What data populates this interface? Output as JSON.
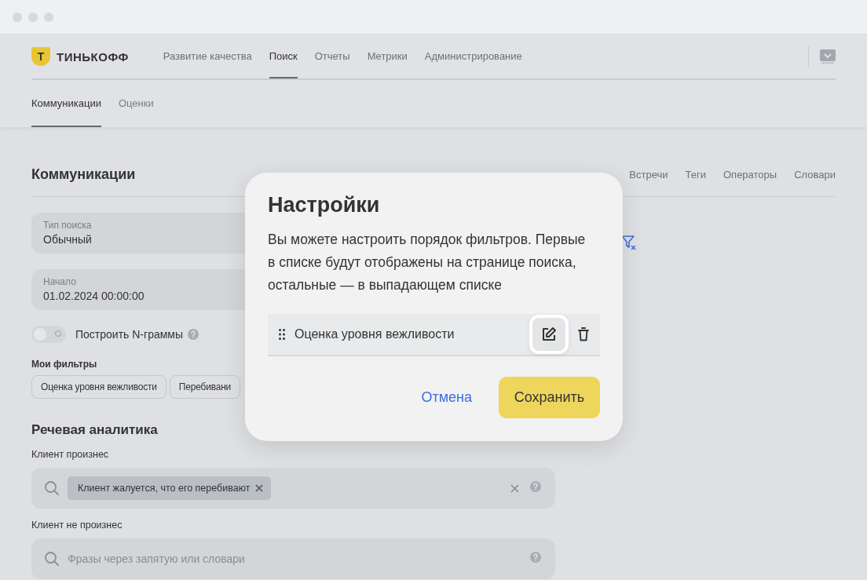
{
  "header": {
    "logo_mark": "Т",
    "logo_text": "ТИНЬКОФФ",
    "nav": [
      {
        "label": "Развитие качества",
        "selected": false
      },
      {
        "label": "Поиск",
        "selected": true
      },
      {
        "label": "Отчеты",
        "selected": false
      },
      {
        "label": "Метрики",
        "selected": false
      },
      {
        "label": "Администрирование",
        "selected": false
      }
    ],
    "subtabs": [
      {
        "label": "Коммуникации",
        "selected": true
      },
      {
        "label": "Оценки",
        "selected": false
      }
    ]
  },
  "page": {
    "title": "Коммуникации",
    "section_tabs": [
      "Встречи",
      "Теги",
      "Операторы",
      "Словари"
    ],
    "fields": [
      {
        "label": "Тип поиска",
        "value": "Обычный"
      },
      {
        "label": "Начало",
        "value": "01.02.2024 00:00:00"
      }
    ],
    "toggle": {
      "label": "Построить N-граммы",
      "on": false
    },
    "my_filters": {
      "title": "Мои фильтры",
      "chips": [
        "Оценка уровня вежливости",
        "Перебивани"
      ]
    },
    "speech": {
      "title": "Речевая аналитика",
      "fields": [
        {
          "label": "Клиент произнес",
          "tags": [
            "Клиент жалуется, что его перебивают"
          ]
        },
        {
          "label": "Клиент не произнес",
          "placeholder": "Фразы через запятую или словари"
        }
      ]
    }
  },
  "modal": {
    "title": "Настройки",
    "text": "Вы можете настроить порядок фильтров. Первые в списке будут отображены на странице поиска, остальные — в выпадающем списке",
    "filters": [
      {
        "name": "Оценка уровня вежливости"
      }
    ],
    "cancel": "Отмена",
    "save": "Сохранить"
  }
}
